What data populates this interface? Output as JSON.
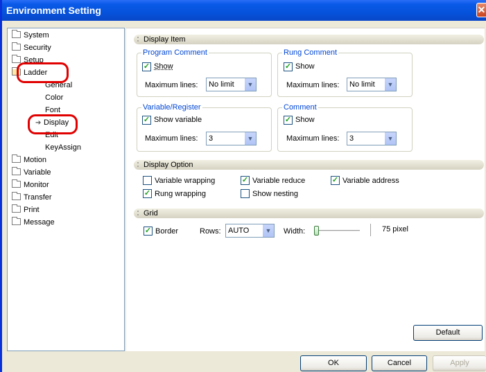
{
  "window": {
    "title": "Environment Setting",
    "close_glyph": "✕"
  },
  "tree": {
    "items": [
      {
        "label": "System",
        "icon": "folder-icon"
      },
      {
        "label": "Security",
        "icon": "folder-icon"
      },
      {
        "label": "Setup",
        "icon": "folder-icon"
      },
      {
        "label": "Ladder",
        "icon": "open-folder-icon"
      },
      {
        "label": "General"
      },
      {
        "label": "Color"
      },
      {
        "label": "Font"
      },
      {
        "label": "Display",
        "icon": "arrow-right-icon",
        "selected": true
      },
      {
        "label": "Edit"
      },
      {
        "label": "KeyAssign"
      },
      {
        "label": "Motion",
        "icon": "folder-icon"
      },
      {
        "label": "Variable",
        "icon": "folder-icon"
      },
      {
        "label": "Monitor",
        "icon": "folder-icon"
      },
      {
        "label": "Transfer",
        "icon": "folder-icon"
      },
      {
        "label": "Print",
        "icon": "folder-icon"
      },
      {
        "label": "Message",
        "icon": "folder-icon"
      }
    ],
    "annotation_color": "#e10000"
  },
  "display_item": {
    "header": "Display Item",
    "program_comment": {
      "title": "Program Comment",
      "show_label": "Show",
      "show_checked": true,
      "max_lines_label": "Maximum lines:",
      "max_lines_value": "No limit"
    },
    "rung_comment": {
      "title": "Rung Comment",
      "show_label": "Show",
      "show_checked": true,
      "max_lines_label": "Maximum lines:",
      "max_lines_value": "No limit"
    },
    "variable_register": {
      "title": "Variable/Register",
      "show_label": "Show variable",
      "show_checked": true,
      "max_lines_label": "Maximum lines:",
      "max_lines_value": "3"
    },
    "comment": {
      "title": "Comment",
      "show_label": "Show",
      "show_checked": true,
      "max_lines_label": "Maximum lines:",
      "max_lines_value": "3"
    }
  },
  "display_option": {
    "header": "Display Option",
    "variable_wrapping": {
      "label": "Variable wrapping",
      "checked": false
    },
    "variable_reduce": {
      "label": "Variable reduce",
      "checked": true
    },
    "variable_address": {
      "label": "Variable address",
      "checked": true
    },
    "rung_wrapping": {
      "label": "Rung wrapping",
      "checked": true
    },
    "show_nesting": {
      "label": "Show nesting",
      "checked": false
    }
  },
  "grid": {
    "header": "Grid",
    "border": {
      "label": "Border",
      "checked": true
    },
    "rows_label": "Rows:",
    "rows_value": "AUTO",
    "width_label": "Width:",
    "width_value": "75 pixel",
    "width_slider_fraction": 0.0
  },
  "buttons": {
    "default": "Default",
    "ok": "OK",
    "cancel": "Cancel",
    "apply": "Apply"
  },
  "check_glyph": "✓",
  "dropdown_glyph": "▼"
}
